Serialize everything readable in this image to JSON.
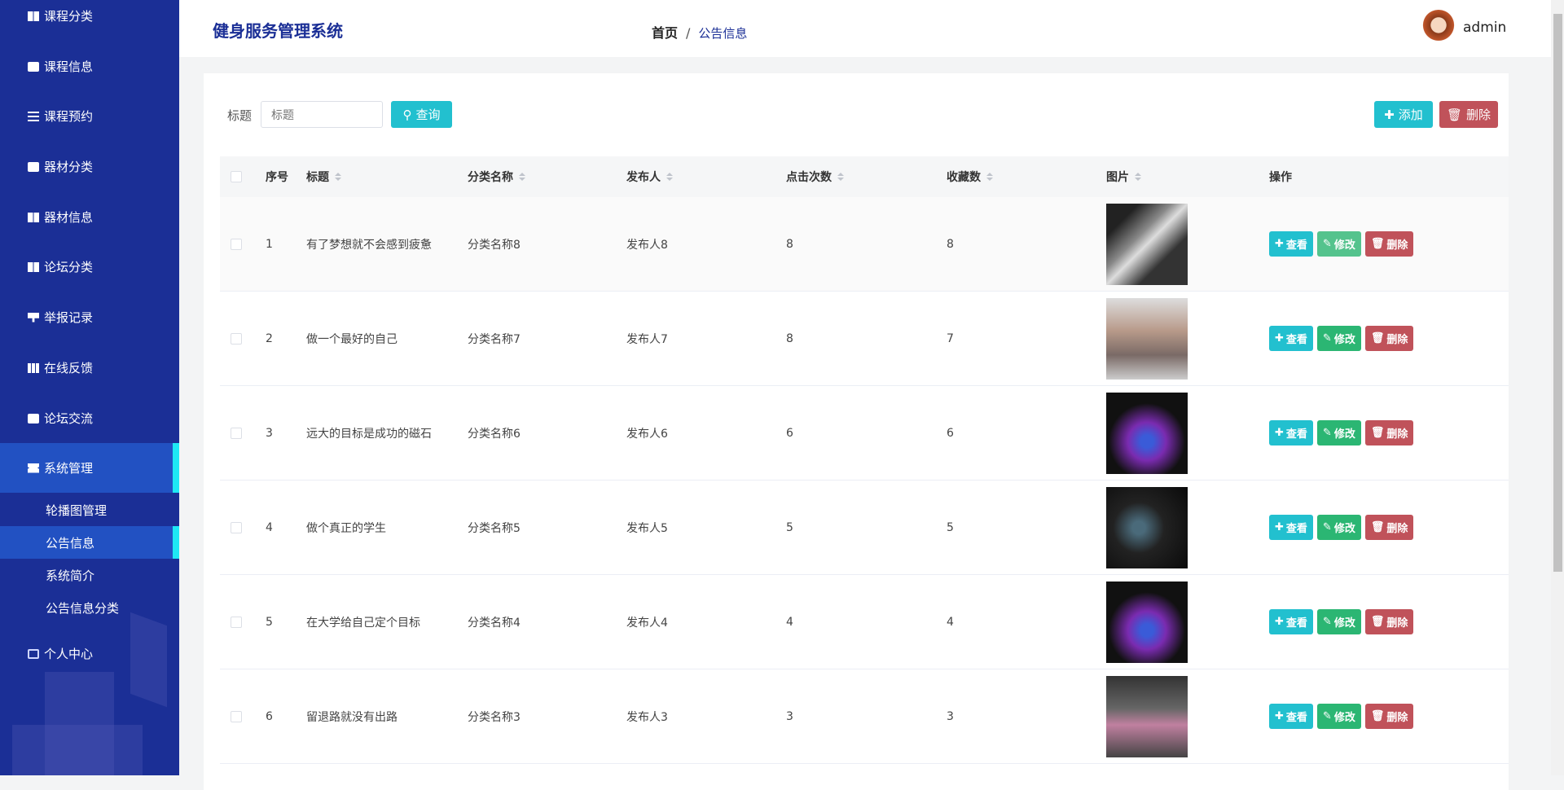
{
  "sidebar": {
    "items": [
      {
        "label": "课程分类",
        "icon": "grid-icon"
      },
      {
        "label": "课程信息",
        "icon": "wallet-icon"
      },
      {
        "label": "课程预约",
        "icon": "list-icon"
      },
      {
        "label": "器材分类",
        "icon": "briefcase-icon"
      },
      {
        "label": "器材信息",
        "icon": "grid-icon"
      },
      {
        "label": "论坛分类",
        "icon": "grid-icon"
      },
      {
        "label": "举报记录",
        "icon": "flag-icon"
      },
      {
        "label": "在线反馈",
        "icon": "table-icon"
      },
      {
        "label": "论坛交流",
        "icon": "monitor-icon"
      },
      {
        "label": "系统管理",
        "icon": "ticket-icon"
      }
    ],
    "sub": [
      "轮播图管理",
      "公告信息",
      "系统简介",
      "公告信息分类"
    ],
    "personal": "个人中心"
  },
  "header": {
    "title": "健身服务管理系统",
    "crumb_home": "首页",
    "crumb_sep": "/",
    "crumb_current": "公告信息",
    "user": "admin"
  },
  "search": {
    "label": "标题",
    "placeholder": "标题",
    "button": "查询",
    "add": "添加",
    "delete": "删除"
  },
  "table": {
    "headers": [
      "序号",
      "标题",
      "分类名称",
      "发布人",
      "点击次数",
      "收藏数",
      "图片",
      "操作"
    ],
    "actions": {
      "view": "查看",
      "edit": "修改",
      "delete": "删除"
    },
    "rows": [
      {
        "no": "1",
        "title": "有了梦想就不会感到疲惫",
        "cat": "分类名称8",
        "author": "发布人8",
        "clicks": "8",
        "fav": "8"
      },
      {
        "no": "2",
        "title": "做一个最好的自己",
        "cat": "分类名称7",
        "author": "发布人7",
        "clicks": "8",
        "fav": "7"
      },
      {
        "no": "3",
        "title": "远大的目标是成功的磁石",
        "cat": "分类名称6",
        "author": "发布人6",
        "clicks": "6",
        "fav": "6"
      },
      {
        "no": "4",
        "title": "做个真正的学生",
        "cat": "分类名称5",
        "author": "发布人5",
        "clicks": "5",
        "fav": "5"
      },
      {
        "no": "5",
        "title": "在大学给自己定个目标",
        "cat": "分类名称4",
        "author": "发布人4",
        "clicks": "4",
        "fav": "4"
      },
      {
        "no": "6",
        "title": "留退路就没有出路",
        "cat": "分类名称3",
        "author": "发布人3",
        "clicks": "3",
        "fav": "3"
      }
    ]
  },
  "colors": {
    "sidebar": "#1b2f96",
    "active": "#2251c2",
    "accent": "#1ee8f4",
    "teal": "#22c0cf",
    "green": "#2bb673",
    "red": "#c0525a"
  }
}
